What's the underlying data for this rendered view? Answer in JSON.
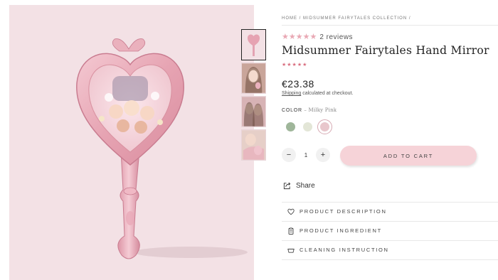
{
  "breadcrumb": {
    "home": "HOME",
    "sep1": " / ",
    "collection": "MIDSUMMER FAIRYTALES COLLECTION",
    "sep2": " /"
  },
  "product": {
    "review_stars": "★★★★★",
    "review_count": "2 reviews",
    "rating": 5,
    "title": "Midsummer Fairytales Hand Mirror",
    "small_stars": "★★★★★",
    "price": "€23.38",
    "shipping_link": "Shipping",
    "shipping_text": " calculated at checkout."
  },
  "color": {
    "label": "COLOR",
    "sep": " – ",
    "selected": "Milky Pink",
    "swatches": [
      {
        "name": "sage-green",
        "hex": "#9fb69a"
      },
      {
        "name": "cream",
        "hex": "#e3e6d7"
      },
      {
        "name": "milky-pink",
        "hex": "#e8c7cc"
      }
    ]
  },
  "quantity": {
    "minus": "−",
    "value": "1",
    "plus": "+"
  },
  "add_to_cart": "ADD TO CART",
  "share": "Share",
  "accordion": [
    {
      "label": "PRODUCT DESCRIPTION",
      "icon": "heart-icon"
    },
    {
      "label": "PRODUCT INGREDIENT",
      "icon": "clipboard-icon"
    },
    {
      "label": "CLEANING INSTRUCTION",
      "icon": "basin-icon"
    }
  ],
  "colors": {
    "background_image": "#f3e1e5",
    "accent_button": "#f6d3d8",
    "star": "#e9a8b4"
  }
}
